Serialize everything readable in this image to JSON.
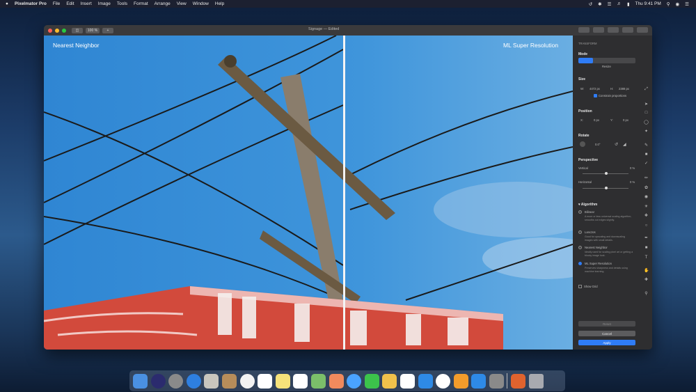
{
  "menubar": {
    "apple": "",
    "app": "Pixelmator Pro",
    "items": [
      "File",
      "Edit",
      "Insert",
      "Image",
      "Tools",
      "Format",
      "Arrange",
      "View",
      "Window",
      "Help"
    ],
    "clock": "Thu 9:41 PM"
  },
  "window": {
    "title": "Signage — Edited",
    "zoom": "100 %",
    "left_label": "Nearest Neighbor",
    "right_label": "ML Super Resolution"
  },
  "panel": {
    "header": "TRANSFORM",
    "mode_label": "Mode",
    "mode_value": "Resize",
    "size_label": "Size",
    "w_label": "W:",
    "w": "4472 px",
    "h_label": "H:",
    "h": "2388 px",
    "constrain": "Constrain proportions",
    "position_label": "Position",
    "x_label": "X:",
    "x": "0 px",
    "y_label": "Y:",
    "y": "0 px",
    "rotate_label": "Rotate",
    "rotate": "0.0°",
    "perspective_label": "Perspective",
    "vertical_label": "Vertical",
    "vertical": "0 %",
    "horizontal_label": "Horizontal",
    "horizontal": "0 %",
    "algorithm_label": "Algorithm",
    "algorithms": [
      {
        "name": "Bilinear",
        "desc": "A more or less universal scaling algorithm, smooths out edges slightly."
      },
      {
        "name": "Lanczos",
        "desc": "Good for upscaling and downscaling images with small details."
      },
      {
        "name": "Nearest Neighbor",
        "desc": "Ideally used for scaling pixel art or getting a blocky image look."
      },
      {
        "name": "ML Super Resolution",
        "desc": "Preserves sharpness and details using machine learning."
      }
    ],
    "show_grid": "Show Grid",
    "reset": "Reset",
    "cancel": "Cancel",
    "apply": "Apply"
  },
  "colors": {
    "accent": "#2f7cf6",
    "sky": "#3a8fd6",
    "sign_red": "#d24a3c"
  }
}
